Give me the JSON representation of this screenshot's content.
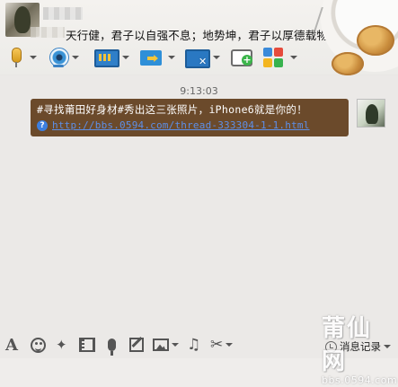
{
  "header": {
    "signature": "天行健，君子以自强不息；地势坤，君子以厚德载物。"
  },
  "toolbar": {
    "items": [
      {
        "name": "voice-call",
        "icon": "microphone-icon",
        "dropdown": true
      },
      {
        "name": "video-call",
        "icon": "webcam-icon",
        "dropdown": true
      },
      {
        "name": "remote-desktop",
        "icon": "screen-share-icon",
        "dropdown": true
      },
      {
        "name": "send-file",
        "icon": "folder-send-icon",
        "dropdown": true
      },
      {
        "name": "remote-assist",
        "icon": "remote-assist-icon",
        "dropdown": true
      },
      {
        "name": "create-discussion",
        "icon": "add-chat-icon",
        "dropdown": false
      },
      {
        "name": "apps",
        "icon": "apps-grid-icon",
        "dropdown": true
      }
    ]
  },
  "chat": {
    "timestamp": "9:13:03",
    "message": {
      "text": "#寻找莆田好身材#秀出这三张照片，iPhone6就是你的！",
      "link": "http://bbs.0594.com/thread-333304-1-1.html"
    }
  },
  "bottom_toolbar": {
    "items": [
      {
        "name": "font",
        "icon": "font-icon",
        "label": "A"
      },
      {
        "name": "emoji",
        "icon": "emoji-icon"
      },
      {
        "name": "magic-expression",
        "icon": "magic-wand-icon"
      },
      {
        "name": "gif",
        "icon": "film-icon"
      },
      {
        "name": "voice-message",
        "icon": "mic-icon"
      },
      {
        "name": "doodle",
        "icon": "edit-icon"
      },
      {
        "name": "send-image",
        "icon": "image-icon",
        "dropdown": true
      },
      {
        "name": "music",
        "icon": "music-note-icon"
      },
      {
        "name": "screenshot",
        "icon": "scissors-icon",
        "dropdown": true
      }
    ],
    "history_label": "消息记录"
  },
  "watermark": {
    "logo": "莆仙网",
    "url": "bbs.0594.com"
  },
  "colors": {
    "bubble_bg": "#6b4a2b",
    "link": "#5d8fe8",
    "chat_bg": "#ebe9e7"
  }
}
